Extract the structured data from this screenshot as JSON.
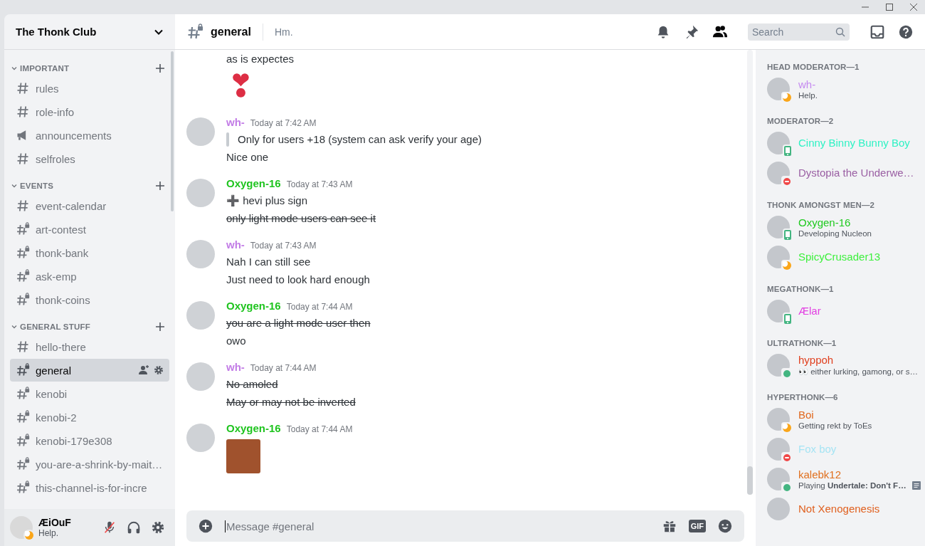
{
  "server": {
    "name": "The Thonk Club"
  },
  "categories": [
    {
      "name": "IMPORTANT",
      "expanded": true,
      "channels": [
        {
          "name": "rules",
          "kind": "text",
          "selected": false
        },
        {
          "name": "role-info",
          "kind": "text",
          "selected": false
        },
        {
          "name": "announcements",
          "kind": "announcement",
          "selected": false
        },
        {
          "name": "selfroles",
          "kind": "text",
          "selected": false
        }
      ]
    },
    {
      "name": "EVENTS",
      "expanded": true,
      "channels": [
        {
          "name": "event-calendar",
          "kind": "text",
          "selected": false
        },
        {
          "name": "art-contest",
          "kind": "locked",
          "selected": false
        },
        {
          "name": "thonk-bank",
          "kind": "locked",
          "selected": false
        },
        {
          "name": "ask-emp",
          "kind": "locked",
          "selected": false
        },
        {
          "name": "thonk-coins",
          "kind": "locked",
          "selected": false
        }
      ]
    },
    {
      "name": "GENERAL STUFF",
      "expanded": true,
      "channels": [
        {
          "name": "hello-there",
          "kind": "text",
          "selected": false
        },
        {
          "name": "general",
          "kind": "locked",
          "selected": true
        },
        {
          "name": "kenobi",
          "kind": "locked",
          "selected": false
        },
        {
          "name": "kenobi-2",
          "kind": "locked",
          "selected": false
        },
        {
          "name": "kenobi-179e308",
          "kind": "locked",
          "selected": false
        },
        {
          "name": "you-are-a-shrink-by-mait…",
          "kind": "locked",
          "selected": false
        },
        {
          "name": "this-channel-is-for-incre",
          "kind": "locked",
          "selected": false
        }
      ]
    }
  ],
  "user": {
    "name": "ÆiOuF",
    "status_text": "Help.",
    "kind": "idle",
    "muted": true
  },
  "channel_header": {
    "name": "general",
    "kind": "locked",
    "topic": "Hm.",
    "search_placeholder": "Search"
  },
  "messages": [
    {
      "lines": [
        {
          "kind": "text",
          "text": "as is expectes",
          "strikethrough": false
        },
        {
          "kind": "emoji",
          "text": "❣",
          "strikethrough": false
        }
      ]
    },
    {
      "author": "wh-",
      "color": "#c27ce6",
      "time": "Today at 7:42 AM",
      "lines": [
        {
          "kind": "quote",
          "text": "Only for users +18 (system can ask verify your age)",
          "strikethrough": false
        },
        {
          "kind": "text",
          "text": "Nice one",
          "strikethrough": false
        }
      ]
    },
    {
      "author": "Oxygen-16",
      "color": "#1fc41f",
      "time": "Today at 7:43 AM",
      "lines": [
        {
          "kind": "text",
          "text": "➕ hevi plus sign",
          "strikethrough": false
        },
        {
          "kind": "text",
          "text": "only light mode users can see it",
          "strikethrough": true
        }
      ]
    },
    {
      "author": "wh-",
      "color": "#c27ce6",
      "time": "Today at 7:43 AM",
      "lines": [
        {
          "kind": "text",
          "text": "Nah I can still see",
          "strikethrough": false
        },
        {
          "kind": "text",
          "text": "Just need to look hard enough",
          "strikethrough": false
        }
      ]
    },
    {
      "author": "Oxygen-16",
      "color": "#1fc41f",
      "time": "Today at 7:44 AM",
      "lines": [
        {
          "kind": "text",
          "text": "you are a light mode user then",
          "strikethrough": true
        },
        {
          "kind": "text",
          "text": "owo",
          "strikethrough": false
        }
      ]
    },
    {
      "author": "wh-",
      "color": "#c27ce6",
      "time": "Today at 7:44 AM",
      "lines": [
        {
          "kind": "text",
          "text": "No amoled",
          "strikethrough": true
        },
        {
          "kind": "text",
          "text": "May or may not be inverted",
          "strikethrough": true
        }
      ]
    },
    {
      "author": "Oxygen-16",
      "color": "#1fc41f",
      "time": "Today at 7:44 AM",
      "lines": [
        {
          "kind": "image"
        }
      ]
    }
  ],
  "composer": {
    "placeholder": "Message #general",
    "gif_label": "GIF"
  },
  "member_groups": [
    {
      "title": "HEAD MODERATOR—1",
      "members": [
        {
          "name": "wh-",
          "color": "#c58af0",
          "kind": "idle",
          "activity": "Help."
        }
      ]
    },
    {
      "title": "MODERATOR—2",
      "members": [
        {
          "name": "Cinny Binny Bunny Boy",
          "color": "#2ef2c4",
          "kind": "mobile"
        },
        {
          "name": "Dystopia the Underwe…",
          "color": "#9a5fa3",
          "kind": "dnd"
        }
      ]
    },
    {
      "title": "THONK AMONGST MEN—2",
      "members": [
        {
          "name": "Oxygen-16",
          "color": "#1ec91e",
          "kind": "mobile",
          "activity": "Developing Nucleon"
        },
        {
          "name": "SpicyCrusader13",
          "color": "#3ef03e",
          "kind": "idle"
        }
      ]
    },
    {
      "title": "MEGATHONK—1",
      "members": [
        {
          "name": "Ælar",
          "color": "#e23fe2",
          "kind": "mobile"
        }
      ]
    },
    {
      "title": "ULTRATHONK—1",
      "members": [
        {
          "name": "hyppoh",
          "color": "#e0401f",
          "kind": "online",
          "activity": "👀 either lurking, gamong, or s…"
        }
      ]
    },
    {
      "title": "HYPERTHONK—6",
      "members": [
        {
          "name": "Boi",
          "color": "#e0681f",
          "kind": "idle",
          "activity": "Getting rekt by ToEs"
        },
        {
          "name": "Fox boy",
          "color": "#a6e4f4",
          "kind": "dnd"
        },
        {
          "name": "kalebk12",
          "color": "#e0701f",
          "kind": "online",
          "activity": "Playing **Undertale: Don't F…**",
          "rich_presence": true
        },
        {
          "name": "Not Xenogenesis",
          "color": "#e0601f",
          "kind": "none"
        }
      ]
    }
  ]
}
